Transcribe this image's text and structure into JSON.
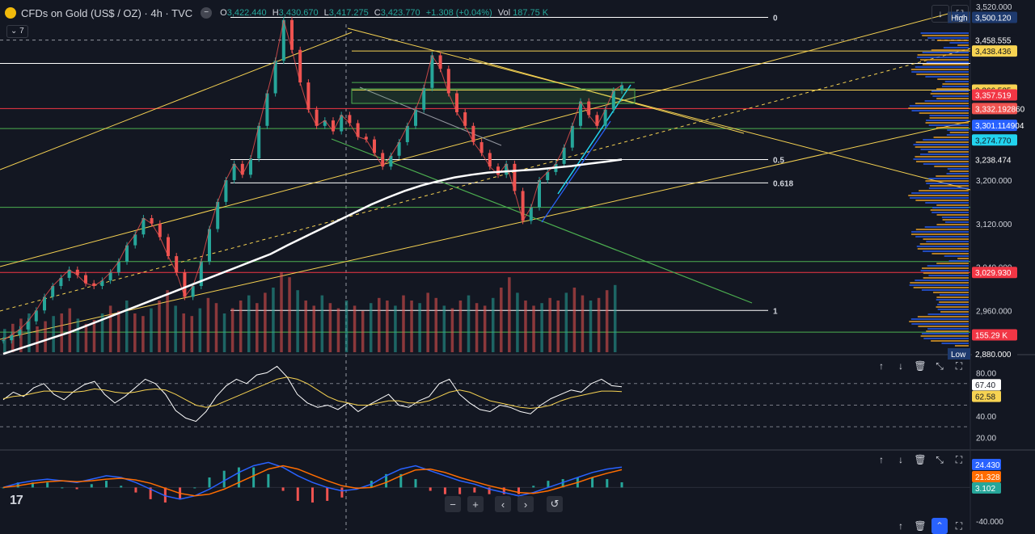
{
  "header": {
    "symbol": "CFDs on Gold (US$ / OZ) · 4h · TVC",
    "open_key": "O",
    "open": "3,422.440",
    "high_key": "H",
    "high": "3,430.670",
    "low_key": "L",
    "low": "3,417.275",
    "close_key": "C",
    "close": "3,423.770",
    "change": "+1.308 (+0.04%)",
    "vol_key": "Vol",
    "vol": "187.75 K",
    "indicators_count": "7"
  },
  "price_axis": {
    "ticks": [
      "3,520.000",
      "3,200.000",
      "3,120.000",
      "3,040.000",
      "2,960.000",
      "2,880.000"
    ],
    "labels": [
      {
        "text": "3,500.120",
        "bg": "#1e3a6e",
        "fg": "#ffffff",
        "tag": "High"
      },
      {
        "text": "3,458.555",
        "bg": "#131722",
        "fg": "#ffffff"
      },
      {
        "text": "3,438.436",
        "bg": "#f7d352",
        "fg": "#131722"
      },
      {
        "text": "3,366.525",
        "bg": "#f7d352",
        "fg": "#131722"
      },
      {
        "text": "3,357.519",
        "bg": "#f23645",
        "fg": "#ffffff"
      },
      {
        "text": "3,332.192860",
        "bg": "#ef5350",
        "fg": "#ffffff"
      },
      {
        "text": "3,301.114904",
        "bg": "#2962ff",
        "fg": "#ffffff"
      },
      {
        "text": "3,274.770",
        "bg": "#22d3ee",
        "fg": "#131722"
      },
      {
        "text": "3,238.474",
        "bg": "#131722",
        "fg": "#ffffff"
      },
      {
        "text": "3,029.930",
        "bg": "#f23645",
        "fg": "#ffffff"
      },
      {
        "text": "155.29 K",
        "bg": "#f23645",
        "fg": "#ffffff"
      },
      {
        "text": "2,880.000",
        "bg": "#131722",
        "fg": "#ffffff",
        "tag": "Low"
      }
    ]
  },
  "fibonacci": [
    "0",
    "0.5",
    "0.618",
    "1"
  ],
  "rsi": {
    "ticks": [
      "80.00",
      "40.00",
      "20.00"
    ],
    "values": [
      "67.40",
      "62.58"
    ],
    "rsi_color": "#ffffff",
    "ma_color": "#f7d352"
  },
  "macd": {
    "ticks": [
      "-40.000"
    ],
    "values": [
      "24.430",
      "21.328",
      "3.102"
    ],
    "colors": [
      "#2962ff",
      "#ff6d00",
      "#26a69a"
    ]
  },
  "chart_data": {
    "type": "line",
    "title": "CFDs on Gold (US$ / OZ) · 4h · TVC",
    "ylim": [
      2880,
      3520
    ],
    "series": [
      {
        "values": [
          2905,
          2915,
          2925,
          2940,
          2960,
          2985,
          3005,
          3020,
          3035,
          3025,
          3010,
          3005,
          3015,
          3030,
          3050,
          3080,
          3100,
          3130,
          3120,
          3095,
          3060,
          3030,
          2985,
          3005,
          3050,
          3110,
          3160,
          3200,
          3230,
          3210,
          3240,
          3300,
          3360,
          3420,
          3495,
          3440,
          3380,
          3330,
          3300,
          3310,
          3290,
          3320,
          3305,
          3280,
          3275,
          3250,
          3225,
          3245,
          3270,
          3300,
          3330,
          3370,
          3430,
          3405,
          3360,
          3325,
          3300,
          3270,
          3250,
          3225,
          3210,
          3230,
          3180,
          3125,
          3150,
          3200,
          3215,
          3230,
          3260,
          3300,
          3345,
          3320,
          3300,
          3330,
          3365,
          3375
        ]
      },
      {
        "values": [
          2880,
          2890,
          2900,
          2910,
          2920,
          2932,
          2944,
          2956,
          2968,
          2980,
          2992,
          3004,
          3016,
          3028,
          3040,
          3052,
          3064,
          3080,
          3095,
          3110,
          3125,
          3140,
          3155,
          3168,
          3180,
          3190,
          3198,
          3205,
          3210,
          3214,
          3216,
          3218,
          3220,
          3223,
          3226,
          3230,
          3234,
          3238
        ]
      }
    ],
    "volume": [
      18,
      22,
      26,
      30,
      20,
      24,
      28,
      30,
      34,
      26,
      22,
      25,
      30,
      36,
      32,
      40,
      30,
      28,
      34,
      40,
      48,
      36,
      30,
      28,
      34,
      42,
      38,
      30,
      34,
      40,
      44,
      38,
      46,
      50,
      62,
      58,
      48,
      40,
      36,
      44,
      38,
      34,
      40,
      36,
      32,
      38,
      42,
      40,
      36,
      44,
      40,
      38,
      46,
      42,
      36,
      34,
      40,
      44,
      38,
      36,
      42,
      50,
      58,
      46,
      40,
      36,
      38,
      42,
      40,
      46,
      50,
      44,
      40,
      42,
      48,
      52
    ],
    "rsi": [
      55,
      62,
      58,
      66,
      70,
      60,
      55,
      63,
      69,
      72,
      60,
      52,
      58,
      66,
      74,
      70,
      60,
      45,
      38,
      35,
      44,
      58,
      68,
      74,
      70,
      78,
      80,
      86,
      76,
      60,
      52,
      48,
      50,
      46,
      52,
      44,
      50,
      55,
      60,
      50,
      48,
      54,
      58,
      70,
      74,
      60,
      52,
      46,
      44,
      50,
      48,
      44,
      42,
      50,
      56,
      60,
      64,
      62,
      70,
      74,
      68,
      67
    ],
    "rsi_ma": [
      56,
      58,
      59,
      61,
      63,
      63,
      62,
      62,
      63,
      65,
      64,
      62,
      61,
      62,
      64,
      65,
      64,
      60,
      55,
      50,
      48,
      50,
      54,
      58,
      62,
      66,
      70,
      74,
      76,
      74,
      70,
      64,
      58,
      54,
      52,
      50,
      50,
      52,
      54,
      54,
      52,
      52,
      54,
      58,
      62,
      64,
      62,
      58,
      54,
      52,
      50,
      48,
      47,
      48,
      50,
      54,
      57,
      59,
      61,
      63,
      63,
      62.58
    ],
    "macd": [
      0,
      5,
      8,
      10,
      8,
      6,
      10,
      14,
      12,
      6,
      -2,
      -10,
      -14,
      -10,
      -2,
      8,
      18,
      26,
      30,
      24,
      14,
      6,
      0,
      -4,
      -2,
      4,
      14,
      22,
      26,
      20,
      14,
      8,
      4,
      -2,
      -6,
      -10,
      -6,
      0,
      6,
      12,
      18,
      22,
      24.4
    ],
    "signal": [
      0,
      2,
      5,
      7,
      8,
      7,
      8,
      10,
      11,
      9,
      5,
      -1,
      -7,
      -10,
      -8,
      -2,
      6,
      14,
      22,
      26,
      22,
      15,
      8,
      2,
      -1,
      0,
      6,
      14,
      21,
      22,
      18,
      12,
      7,
      2,
      -2,
      -6,
      -7,
      -4,
      1,
      6,
      12,
      17,
      21.3
    ]
  },
  "toolbar": {
    "up_icon": "arrow-up-icon",
    "down_icon": "arrow-down-icon",
    "delete_icon": "trash-icon",
    "collapse_icon": "collapse-icon",
    "maximize_icon": "maximize-icon"
  },
  "nav": {
    "minus": "−",
    "plus": "+",
    "left": "‹",
    "right": "›",
    "reset": "↺"
  },
  "logo": "17"
}
